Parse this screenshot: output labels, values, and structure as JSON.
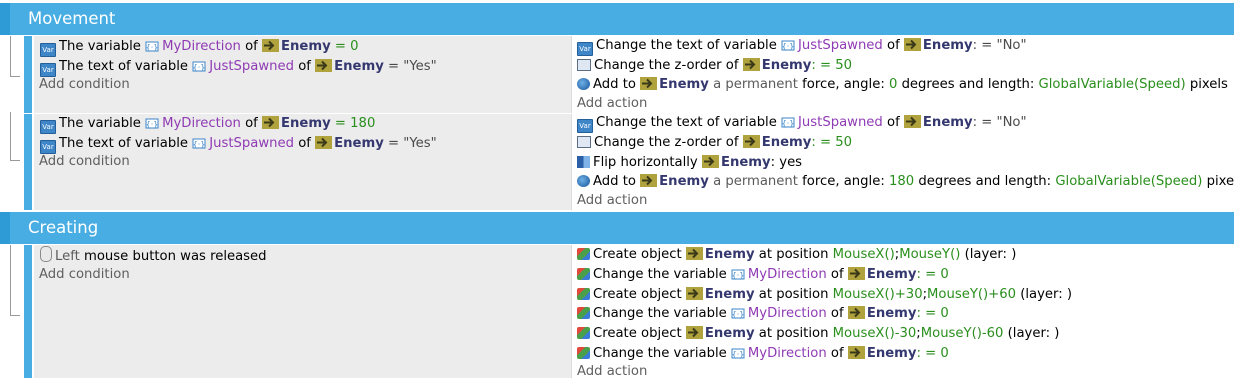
{
  "groups": {
    "movement": {
      "title": "Movement"
    },
    "creating": {
      "title": "Creating"
    }
  },
  "common": {
    "add_condition": "Add condition",
    "add_action": "Add action",
    "enemy": "Enemy",
    "of": "of",
    "the_variable": "The variable",
    "the_text_of_variable": "The text of variable",
    "change_text_of_variable": "Change the text of variable",
    "change_variable": "Change the variable",
    "change_zorder": "Change the z-order of",
    "add_to": "Add to",
    "create_object": "Create object",
    "at_position": "at position",
    "layer_suffix": "(layer: )",
    "permanent_force": "a permanent",
    "force_angle": "force, angle:",
    "degrees_length": "degrees and length:",
    "pixels": "pixels",
    "flip_horizontally": "Flip horizontally",
    "yes": ": yes",
    "var_mydirection": "MyDirection",
    "var_justspawned": "JustSpawned",
    "eq": "=",
    "assign_eq": ": =",
    "str_no": "\"No\"",
    "str_yes": "\"Yes\"",
    "zorder_val": "50",
    "speed_expr": "GlobalVariable(Speed)",
    "mouse_icon": "mouse-icon",
    "var_icon": "variable-icon",
    "obj_icon": "object-arrow-icon"
  },
  "event1": {
    "cond_dir_value": "0",
    "force_angle_value": "0"
  },
  "event2": {
    "cond_dir_value": "180",
    "force_angle_value": "180"
  },
  "event3": {
    "cond_left": "Left",
    "cond_rest": "mouse button was released",
    "create1_x": "MouseX()",
    "create1_y": "MouseY()",
    "create2_x": "MouseX()+30",
    "create2_y": "MouseY()+60",
    "create3_x": "MouseX()-30",
    "create3_y": "MouseY()-60",
    "dir_value": "0",
    "semicolon": ";"
  }
}
